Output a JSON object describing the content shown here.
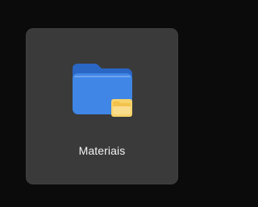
{
  "item": {
    "label": "Materiais",
    "icon": "folder-icon",
    "overlay_icon": "folder-overlay-icon"
  },
  "colors": {
    "background": "#0b0b0b",
    "tile": "#3a3a3a",
    "folder_front": "#3f86e6",
    "folder_back": "#2a66c4",
    "overlay": "#f7d36a"
  }
}
